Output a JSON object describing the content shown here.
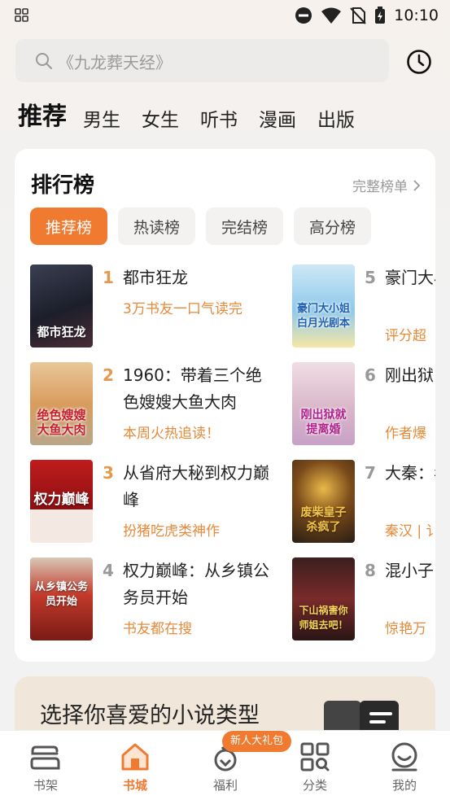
{
  "status_bar": {
    "time": "10:10"
  },
  "search": {
    "placeholder": "《九龙葬天经》"
  },
  "tabs": [
    {
      "label": "推荐"
    },
    {
      "label": "男生"
    },
    {
      "label": "女生"
    },
    {
      "label": "听书"
    },
    {
      "label": "漫画"
    },
    {
      "label": "出版"
    }
  ],
  "ranking": {
    "title": "排行榜",
    "more_label": "完整榜单",
    "tabs": [
      {
        "label": "推荐榜"
      },
      {
        "label": "热读榜"
      },
      {
        "label": "完结榜"
      },
      {
        "label": "高分榜"
      }
    ],
    "books": [
      {
        "rank": "1",
        "title": "都市狂龙",
        "tag": "3万书友一口气读完",
        "cover_text": "都市狂龙"
      },
      {
        "rank": "2",
        "title": "1960：带着三个绝色嫂嫂大鱼大肉",
        "tag": "本周火热追读！",
        "cover_text": "绝色嫂嫂大鱼大肉"
      },
      {
        "rank": "3",
        "title": "从省府大秘到权力巅峰",
        "tag": "扮猪吃虎类神作",
        "cover_text": "权力巅峰"
      },
      {
        "rank": "4",
        "title": "权力巅峰：从乡镇公务员开始",
        "tag": "书友都在搜",
        "cover_text": "从乡镇公务员开始"
      },
      {
        "rank": "5",
        "title": "豪门大小姐，白月光",
        "tag": "评分超",
        "cover_text": "豪门大小姐白月光剧本"
      },
      {
        "rank": "6",
        "title": "刚出狱，渣父子",
        "tag": "作者爆",
        "cover_text": "刚出狱就提离婚"
      },
      {
        "rank": "7",
        "title": "大秦：年，废",
        "tag": "秦汉 | 讠",
        "cover_text": "废柴皇子杀疯了"
      },
      {
        "rank": "8",
        "title": "混小子，师娘啊",
        "tag": "惊艳万",
        "cover_text": "下山祸害你师姐去吧！"
      }
    ]
  },
  "banner": {
    "text": "选择你喜爱的小说类型"
  },
  "bottom_nav": {
    "badge": "新人大礼包",
    "items": [
      {
        "label": "书架"
      },
      {
        "label": "书城"
      },
      {
        "label": "福利"
      },
      {
        "label": "分类"
      },
      {
        "label": "我的"
      }
    ]
  },
  "colors": {
    "accent": "#f07a30",
    "rank_highlight": "#e39a4e",
    "tag": "#e58a3a"
  }
}
